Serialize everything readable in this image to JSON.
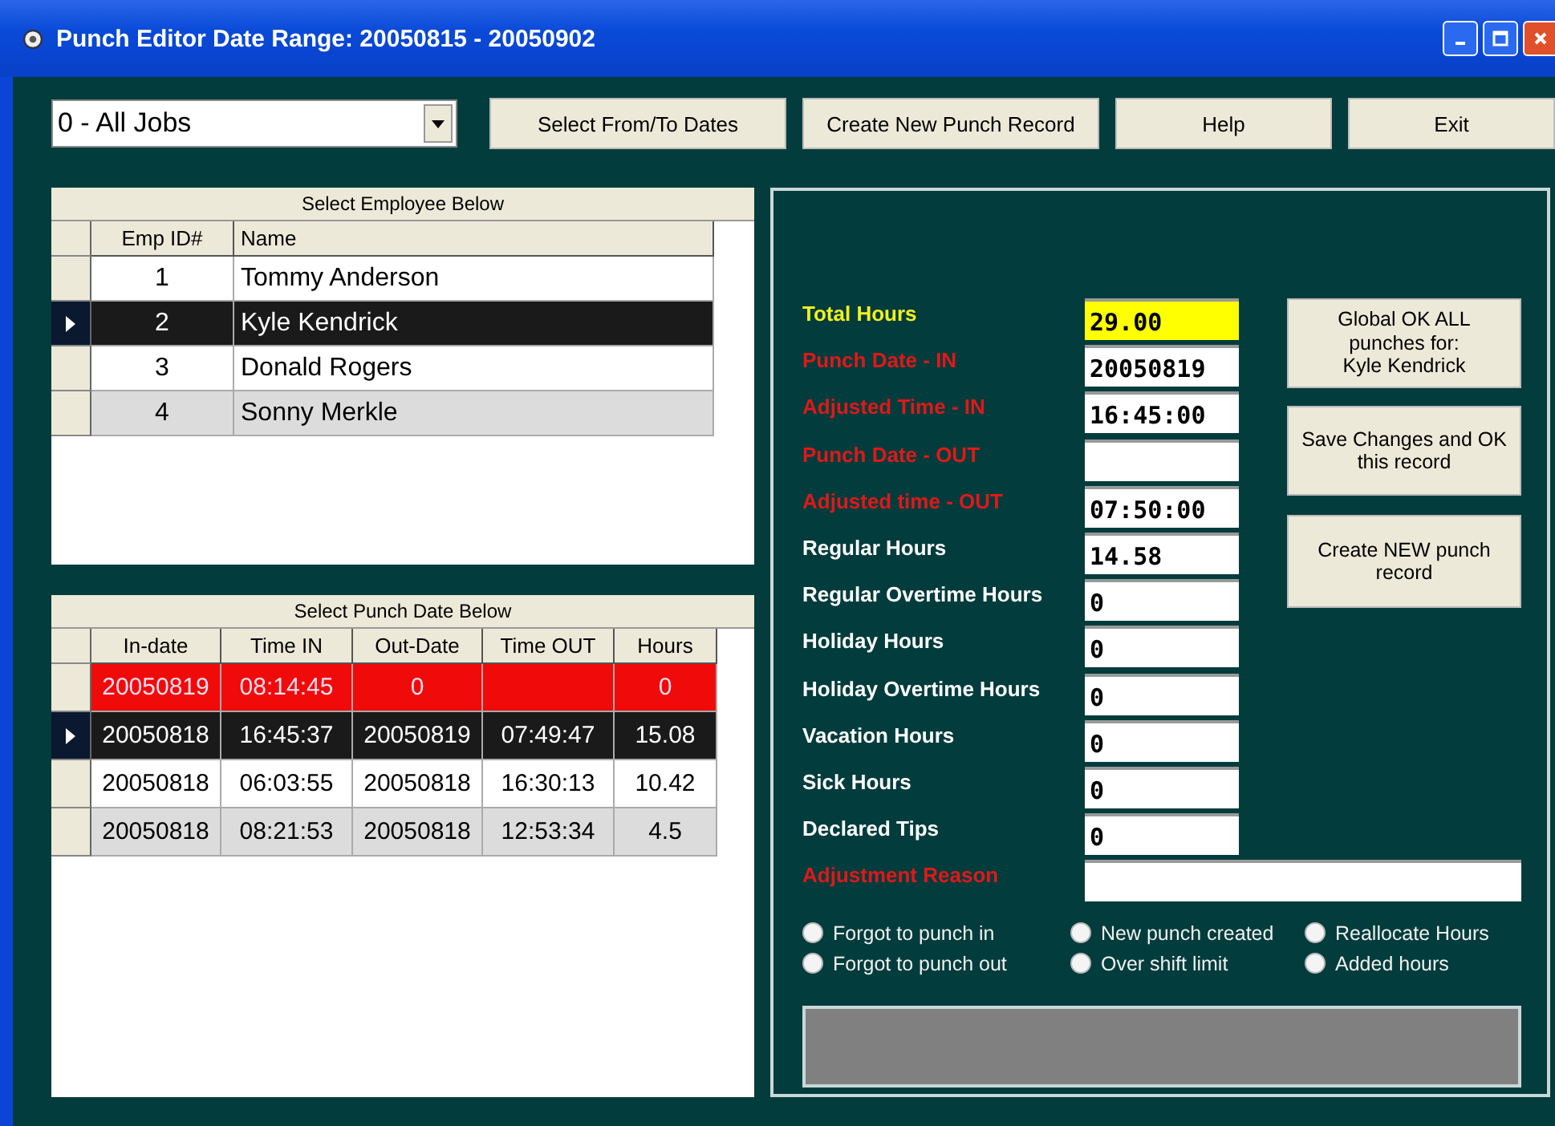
{
  "window": {
    "title": "Punch Editor Date Range: 20050815 - 20050902"
  },
  "toolbar": {
    "job_dropdown": {
      "value": "0 - All Jobs"
    },
    "buttons": [
      "Select From/To Dates",
      "Create New Punch Record",
      "Help",
      "Exit"
    ]
  },
  "employee_grid": {
    "title": "Select Employee Below",
    "columns": [
      "Emp ID#",
      "Name"
    ],
    "rows": [
      {
        "cells": [
          "1",
          "Tommy Anderson"
        ],
        "selected": false,
        "shaded": false
      },
      {
        "cells": [
          "2",
          "Kyle Kendrick"
        ],
        "selected": true,
        "shaded": false
      },
      {
        "cells": [
          "3",
          "Donald Rogers"
        ],
        "selected": false,
        "shaded": false
      },
      {
        "cells": [
          "4",
          "Sonny Merkle"
        ],
        "selected": false,
        "shaded": true
      }
    ]
  },
  "punch_grid": {
    "title": "Select Punch Date Below",
    "columns": [
      "In-date",
      "Time IN",
      "Out-Date",
      "Time OUT",
      "Hours"
    ],
    "rows": [
      {
        "cells": [
          "20050819",
          "08:14:45",
          "0",
          null,
          "0"
        ],
        "selected": false,
        "flagged": true,
        "shaded": false
      },
      {
        "cells": [
          "20050818",
          "16:45:37",
          "20050819",
          "07:49:47",
          "15.08"
        ],
        "selected": true,
        "flagged": false,
        "shaded": false
      },
      {
        "cells": [
          "20050818",
          "06:03:55",
          "20050818",
          "16:30:13",
          "10.42"
        ],
        "selected": false,
        "flagged": false,
        "shaded": false
      },
      {
        "cells": [
          "20050818",
          "08:21:53",
          "20050818",
          "12:53:34",
          "4.5"
        ],
        "selected": false,
        "flagged": false,
        "shaded": true
      }
    ]
  },
  "editor": {
    "fields": [
      {
        "label": "Total Hours",
        "color": "#f0f020",
        "value": "29.00",
        "highlighted": true
      },
      {
        "label": "Punch Date - IN",
        "color": "#e01818",
        "value": "20050819",
        "highlighted": false
      },
      {
        "label": "Adjusted Time - IN",
        "color": "#e01818",
        "value": "16:45:00",
        "highlighted": false
      },
      {
        "label": "Punch Date - OUT",
        "color": "#e01818",
        "highlighted": false
      },
      {
        "label": "Adjusted time - OUT",
        "color": "#e01818",
        "value": "07:50:00",
        "highlighted": false
      },
      {
        "label": "Regular Hours",
        "color": "#ffffff",
        "value": "14.58",
        "highlighted": false
      },
      {
        "label": "Regular Overtime Hours",
        "color": "#ffffff",
        "value": "0",
        "highlighted": false
      },
      {
        "label": "Holiday Hours",
        "color": "#ffffff",
        "value": "0",
        "highlighted": false
      },
      {
        "label": "Holiday Overtime Hours",
        "color": "#ffffff",
        "value": "0",
        "highlighted": false
      },
      {
        "label": "Vacation Hours",
        "color": "#ffffff",
        "value": "0",
        "highlighted": false
      },
      {
        "label": "Sick Hours",
        "color": "#ffffff",
        "value": "0",
        "highlighted": false
      },
      {
        "label": "Declared Tips",
        "color": "#ffffff",
        "value": "0",
        "highlighted": false
      }
    ],
    "buttons": [
      [
        "Global OK ALL",
        "punches for:",
        "Kyle Kendrick"
      ],
      [
        "Save Changes and OK",
        "this record"
      ],
      [
        "Create NEW punch",
        "record"
      ]
    ],
    "adjustment_reason": {
      "label": "Adjustment Reason",
      "color": "#e01818"
    },
    "reasons": [
      {
        "label": "Forgot to punch in",
        "selected": false
      },
      {
        "label": "New punch created",
        "selected": false
      },
      {
        "label": "Reallocate Hours",
        "selected": false
      },
      {
        "label": "Forgot to punch out",
        "selected": false
      },
      {
        "label": "Over shift limit",
        "selected": false
      },
      {
        "label": "Added hours",
        "selected": false
      }
    ]
  }
}
